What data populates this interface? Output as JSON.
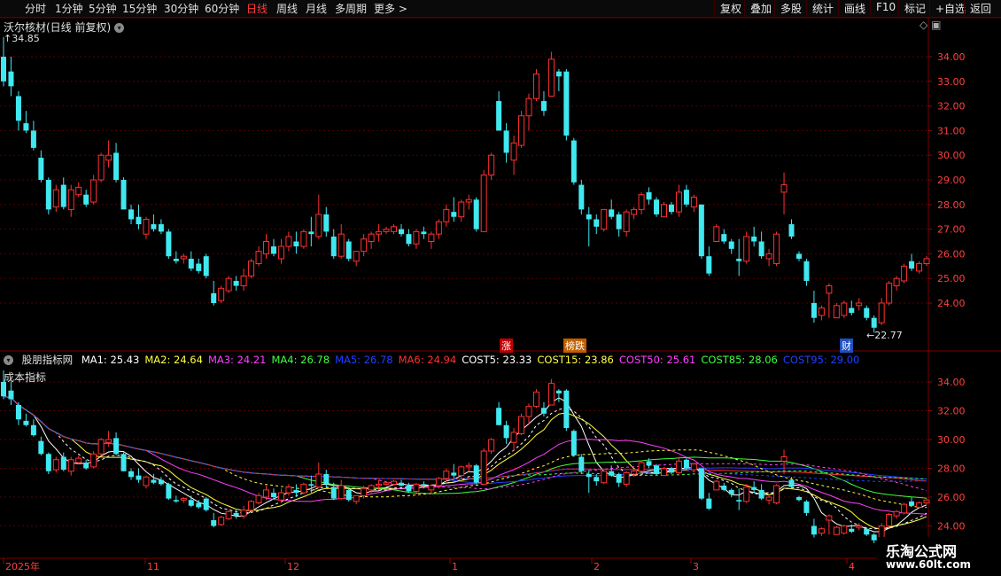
{
  "toolbar": {
    "periods": [
      "分时",
      "1分钟",
      "5分钟",
      "15分钟",
      "30分钟",
      "60分钟",
      "日线",
      "周线",
      "月线",
      "多周期",
      "更多 >"
    ],
    "active_period": "日线",
    "right_buttons": [
      "复权",
      "叠加",
      "多股",
      "统计",
      "画线",
      "F10",
      "标记",
      "+自选",
      "返回"
    ]
  },
  "main_panel": {
    "title": "沃尔核材(日线 前复权)",
    "high_marker": "34.85",
    "low_marker": "22.77",
    "badges": [
      {
        "text": "涨",
        "bg": "#c00000",
        "color": "#ffffff"
      },
      {
        "text": "榜跌",
        "bg": "#c06000",
        "color": "#ffffff"
      },
      {
        "text": "财",
        "bg": "#2050c0",
        "color": "#ffffff"
      }
    ],
    "yticks": [
      "34.00",
      "33.00",
      "32.00",
      "31.00",
      "30.00",
      "29.00",
      "28.00",
      "27.00",
      "26.00",
      "25.00",
      "24.00"
    ]
  },
  "indicator_panel": {
    "title": "股朋指标网",
    "subtitle": "成本指标",
    "legend": [
      {
        "label": "MA1: 25.43",
        "color": "#ffffff"
      },
      {
        "label": "MA2: 24.64",
        "color": "#ffff40"
      },
      {
        "label": "MA3: 24.21",
        "color": "#ff40ff"
      },
      {
        "label": "MA4: 26.78",
        "color": "#40ff40"
      },
      {
        "label": "MA5: 26.78",
        "color": "#2040ff"
      },
      {
        "label": "MA6: 24.94",
        "color": "#ff3030"
      },
      {
        "label": "COST5: 23.33",
        "color": "#ffffff"
      },
      {
        "label": "COST15: 23.86",
        "color": "#ffff40"
      },
      {
        "label": "COST50: 25.61",
        "color": "#ff40ff"
      },
      {
        "label": "COST85: 28.06",
        "color": "#40ff40"
      },
      {
        "label": "COST95: 29.00",
        "color": "#2040ff"
      }
    ],
    "yticks": [
      "34.00",
      "32.00",
      "30.00",
      "28.00",
      "26.00",
      "24.00"
    ]
  },
  "x_axis": {
    "labels": [
      "2025年",
      "11",
      "12",
      "1",
      "2",
      "3",
      "4"
    ]
  },
  "watermark": {
    "line1": "乐淘公式网",
    "line2": "www.60lt.com"
  },
  "chart_data": {
    "type": "candlestick",
    "title": "沃尔核材(日线 前复权)",
    "period": "日线",
    "y_range": [
      23.0,
      35.2
    ],
    "price_high": 34.85,
    "price_low": 22.77,
    "colors": {
      "up": "#ff3030",
      "down": "#40e8f0"
    },
    "candles": [
      [
        34.0,
        34.8,
        32.8,
        33.0
      ],
      [
        33.4,
        34.0,
        32.4,
        32.8
      ],
      [
        32.4,
        32.6,
        31.0,
        31.4
      ],
      [
        31.3,
        31.8,
        30.9,
        31.0
      ],
      [
        31.0,
        31.4,
        30.2,
        30.3
      ],
      [
        29.9,
        30.2,
        28.9,
        29.0
      ],
      [
        29.0,
        29.1,
        27.6,
        27.8
      ],
      [
        27.9,
        28.8,
        27.7,
        28.6
      ],
      [
        28.8,
        29.1,
        27.8,
        27.9
      ],
      [
        27.8,
        28.8,
        27.5,
        28.6
      ],
      [
        28.4,
        28.9,
        28.3,
        28.7
      ],
      [
        28.4,
        28.6,
        27.9,
        28.0
      ],
      [
        28.1,
        29.2,
        28.0,
        29.0
      ],
      [
        29.0,
        30.1,
        28.9,
        30.0
      ],
      [
        29.8,
        30.6,
        29.5,
        30.0
      ],
      [
        30.1,
        30.5,
        28.9,
        29.0
      ],
      [
        29.0,
        29.1,
        27.8,
        27.8
      ],
      [
        27.8,
        28.0,
        27.2,
        27.4
      ],
      [
        27.5,
        28.0,
        27.0,
        27.2
      ],
      [
        26.8,
        27.5,
        26.6,
        27.4
      ],
      [
        27.2,
        27.6,
        26.9,
        27.0
      ],
      [
        27.2,
        27.4,
        26.8,
        26.9
      ],
      [
        26.9,
        27.0,
        25.8,
        25.9
      ],
      [
        25.8,
        26.1,
        25.6,
        25.7
      ],
      [
        25.8,
        26.0,
        25.6,
        25.9
      ],
      [
        25.8,
        26.1,
        25.3,
        25.4
      ],
      [
        25.6,
        25.8,
        25.2,
        25.3
      ],
      [
        25.9,
        26.0,
        25.0,
        25.1
      ],
      [
        24.4,
        24.9,
        23.9,
        24.0
      ],
      [
        24.1,
        24.7,
        24.0,
        24.6
      ],
      [
        24.5,
        25.1,
        24.4,
        25.0
      ],
      [
        24.9,
        25.1,
        24.5,
        24.7
      ],
      [
        24.7,
        25.4,
        24.5,
        25.1
      ],
      [
        25.1,
        25.8,
        25.0,
        25.7
      ],
      [
        25.6,
        26.3,
        25.5,
        26.1
      ],
      [
        26.0,
        26.8,
        25.8,
        26.5
      ],
      [
        26.3,
        26.6,
        25.9,
        26.0
      ],
      [
        25.8,
        26.6,
        25.6,
        26.3
      ],
      [
        26.3,
        26.9,
        26.1,
        26.7
      ],
      [
        26.5,
        26.9,
        26.0,
        26.3
      ],
      [
        26.3,
        27.0,
        26.2,
        26.9
      ],
      [
        26.9,
        27.5,
        26.3,
        26.8
      ],
      [
        26.7,
        28.4,
        26.6,
        27.6
      ],
      [
        27.6,
        27.9,
        26.7,
        26.9
      ],
      [
        26.7,
        27.0,
        25.8,
        25.9
      ],
      [
        25.9,
        27.2,
        25.8,
        26.8
      ],
      [
        26.5,
        26.6,
        25.7,
        25.8
      ],
      [
        25.7,
        26.1,
        25.5,
        26.1
      ],
      [
        26.1,
        26.8,
        25.9,
        26.6
      ],
      [
        26.5,
        26.9,
        26.2,
        26.8
      ],
      [
        26.8,
        27.2,
        26.5,
        26.9
      ],
      [
        26.9,
        27.1,
        26.8,
        27.0
      ],
      [
        26.9,
        27.2,
        26.8,
        27.1
      ],
      [
        27.0,
        27.2,
        26.7,
        26.8
      ],
      [
        26.8,
        27.0,
        26.3,
        26.4
      ],
      [
        26.4,
        27.0,
        26.2,
        26.9
      ],
      [
        26.9,
        27.1,
        26.6,
        26.8
      ],
      [
        26.5,
        26.9,
        26.2,
        26.8
      ],
      [
        26.8,
        27.4,
        26.6,
        27.3
      ],
      [
        27.3,
        28.0,
        27.1,
        27.8
      ],
      [
        27.7,
        28.3,
        27.3,
        27.5
      ],
      [
        27.5,
        28.2,
        27.3,
        28.1
      ],
      [
        28.1,
        28.4,
        27.8,
        28.2
      ],
      [
        28.2,
        28.3,
        26.9,
        27.0
      ],
      [
        26.9,
        29.4,
        26.9,
        29.2
      ],
      [
        29.2,
        30.1,
        29.0,
        30.0
      ],
      [
        32.2,
        32.6,
        31.0,
        31.0
      ],
      [
        31.0,
        31.3,
        29.7,
        30.1
      ],
      [
        29.8,
        30.8,
        29.2,
        30.5
      ],
      [
        30.4,
        31.8,
        30.3,
        31.6
      ],
      [
        31.6,
        32.5,
        31.0,
        32.3
      ],
      [
        32.3,
        33.5,
        32.2,
        33.3
      ],
      [
        32.2,
        32.6,
        31.6,
        31.8
      ],
      [
        32.4,
        34.2,
        32.4,
        33.9
      ],
      [
        33.4,
        33.5,
        32.6,
        33.2
      ],
      [
        33.4,
        33.5,
        30.6,
        30.8
      ],
      [
        30.6,
        30.7,
        28.8,
        28.9
      ],
      [
        28.8,
        29.0,
        27.6,
        27.8
      ],
      [
        27.6,
        27.9,
        26.3,
        27.4
      ],
      [
        27.4,
        27.6,
        26.8,
        27.1
      ],
      [
        27.0,
        27.8,
        26.9,
        27.8
      ],
      [
        27.8,
        28.2,
        27.4,
        27.5
      ],
      [
        27.6,
        27.7,
        26.7,
        27.0
      ],
      [
        26.9,
        27.8,
        26.7,
        27.7
      ],
      [
        27.6,
        27.9,
        27.4,
        27.8
      ],
      [
        27.8,
        28.5,
        27.6,
        28.4
      ],
      [
        28.5,
        28.7,
        28.0,
        28.2
      ],
      [
        28.2,
        28.3,
        27.5,
        27.6
      ],
      [
        27.5,
        28.1,
        27.5,
        28.0
      ],
      [
        28.0,
        28.1,
        27.6,
        27.7
      ],
      [
        27.7,
        28.8,
        27.5,
        28.5
      ],
      [
        28.6,
        28.8,
        27.9,
        28.0
      ],
      [
        27.9,
        28.4,
        27.7,
        28.3
      ],
      [
        28.0,
        28.0,
        25.8,
        25.9
      ],
      [
        25.9,
        26.3,
        25.1,
        25.2
      ],
      [
        26.5,
        27.2,
        26.5,
        27.1
      ],
      [
        26.8,
        27.0,
        26.4,
        26.5
      ],
      [
        26.5,
        26.6,
        26.0,
        26.2
      ],
      [
        25.8,
        26.6,
        25.1,
        25.7
      ],
      [
        25.7,
        26.9,
        25.6,
        26.7
      ],
      [
        26.7,
        27.1,
        26.3,
        26.5
      ],
      [
        26.5,
        26.9,
        25.8,
        25.9
      ],
      [
        25.8,
        26.2,
        25.5,
        26.0
      ],
      [
        25.6,
        26.9,
        25.5,
        26.8
      ],
      [
        28.5,
        29.3,
        27.6,
        28.8
      ],
      [
        27.2,
        27.4,
        26.6,
        26.7
      ],
      [
        26.0,
        26.1,
        25.7,
        25.8
      ],
      [
        25.7,
        25.8,
        24.7,
        24.9
      ],
      [
        24.0,
        24.5,
        23.2,
        23.4
      ],
      [
        23.5,
        23.9,
        23.3,
        23.8
      ],
      [
        24.4,
        24.8,
        23.4,
        24.7
      ],
      [
        23.4,
        24.0,
        23.4,
        23.9
      ],
      [
        23.5,
        24.1,
        23.4,
        24.0
      ],
      [
        23.8,
        24.1,
        23.5,
        23.6
      ],
      [
        23.9,
        24.2,
        23.7,
        24.0
      ],
      [
        23.8,
        23.9,
        23.3,
        23.4
      ],
      [
        23.4,
        23.5,
        22.8,
        23.0
      ],
      [
        23.2,
        24.2,
        23.1,
        24.0
      ],
      [
        24.0,
        24.9,
        23.9,
        24.8
      ],
      [
        24.7,
        25.1,
        24.5,
        25.0
      ],
      [
        24.9,
        25.6,
        24.8,
        25.5
      ],
      [
        25.7,
        26.0,
        25.3,
        25.4
      ],
      [
        25.3,
        25.7,
        25.2,
        25.6
      ],
      [
        25.6,
        25.9,
        25.5,
        25.8
      ]
    ]
  }
}
